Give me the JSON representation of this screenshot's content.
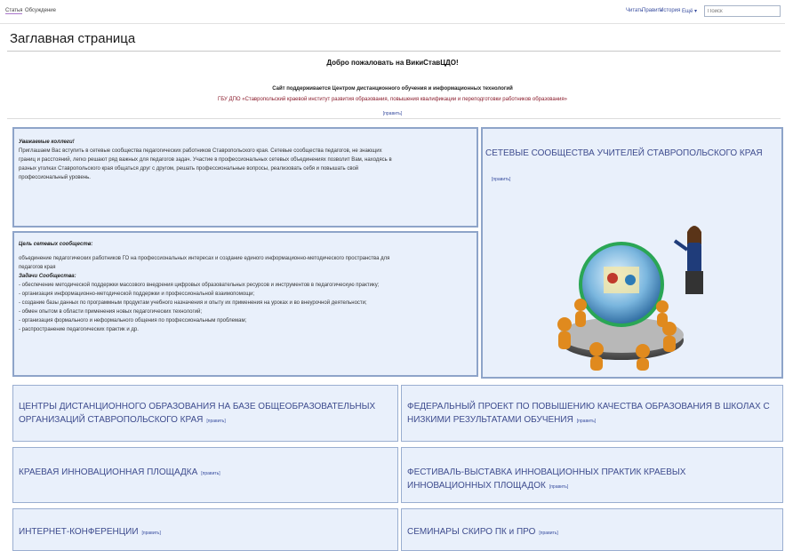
{
  "topbar": {
    "tabs": [
      "Статья",
      "Обсуждение"
    ],
    "right_tabs": [
      "Читать",
      "Править",
      "История",
      "Ещё ▾"
    ],
    "search_placeholder": "Поиск"
  },
  "page": {
    "title": "Заглавная страница",
    "welcome": "Добро пожаловать на ВикиСтавЦДО!",
    "support": "Сайт поддерживается Центром дистанционного обучения и информационных технологий",
    "org": "ГБУ ДПО «Ставропольский краевой институт развития образования, повышения квалификации и переподготовки работников образования»",
    "edit": "[править]"
  },
  "blocks": {
    "intro": {
      "heading": "Уважаемые коллеги!",
      "lines": [
        "Приглашаем Вас вступить в сетевые сообщества педагогических работников Ставропольского края. Сетевые сообщества педагогов, не знающих",
        "границ и расстояний, легко решают ряд важных для педагогов задач. Участие в профессиональных сетевых объединениях позволит Вам, находясь в",
        "разных уголках Ставропольского края общаться друг с другом, решать профессиональные вопросы, реализовать себя и повышать свой",
        "профессиональный уровень."
      ]
    },
    "goal": {
      "heading": "Цель сетевых сообществ:",
      "lines": [
        "объединение педагогических работников ГО на профессиональных интересах и создание единого информационно-методического пространства для",
        "педагогов края"
      ],
      "tasks_heading": "Задачи Сообщества:",
      "tasks": [
        "- обеспечение методической поддержки массового внедрения цифровых образовательных ресурсов и инструментов в педагогическую практику;",
        "- организация информационно-методической поддержки и профессиональной взаимопомощи;",
        "- создание базы данных по программным продуктам учебного назначения и опыту их применения на уроках и во внеурочной деятельности;",
        "- обмен опытом в области применения новых педагогических технологий;",
        "- организация формального и неформального общения по профессиональным проблемам;",
        "- распространение педагогических практик и др."
      ]
    },
    "networks": {
      "title": "СЕТЕВЫЕ СООБЩЕСТВА УЧИТЕЛЕЙ СТАВРОПОЛЬСКОГО КРАЯ"
    },
    "centers": {
      "title": "ЦЕНТРЫ ДИСТАНЦИОННОГО ОБРАЗОВАНИЯ НА БАЗЕ ОБЩЕОБРАЗОВАТЕЛЬНЫХ ОРГАНИЗАЦИЙ СТАВРОПОЛЬСКОГО КРАЯ"
    },
    "federal": {
      "title": "ФЕДЕРАЛЬНЫЙ ПРОЕКТ ПО ПОВЫШЕНИЮ КАЧЕСТВА ОБРАЗОВАНИЯ В ШКОЛАХ С НИЗКИМИ РЕЗУЛЬТАТАМИ ОБУЧЕНИЯ"
    },
    "innov": {
      "title": "КРАЕВАЯ ИННОВАЦИОННАЯ ПЛОЩАДКА"
    },
    "festival": {
      "title": "ФЕСТИВАЛЬ-ВЫСТАВКА ИННОВАЦИОННЫХ ПРАКТИК КРАЕВЫХ ИННОВАЦИОННЫХ ПЛОЩАДОК"
    },
    "conf": {
      "title": "ИНТЕРНЕТ-КОНФЕРЕНЦИИ"
    },
    "seminars": {
      "title": "СЕМИНАРЫ СКИРО ПК и ПРО"
    }
  },
  "colors": {
    "box_bg": "#e9f0fb",
    "box_border": "#9aaed0",
    "title_blue": "#3e4c8e",
    "org_red": "#8a1c2c"
  }
}
